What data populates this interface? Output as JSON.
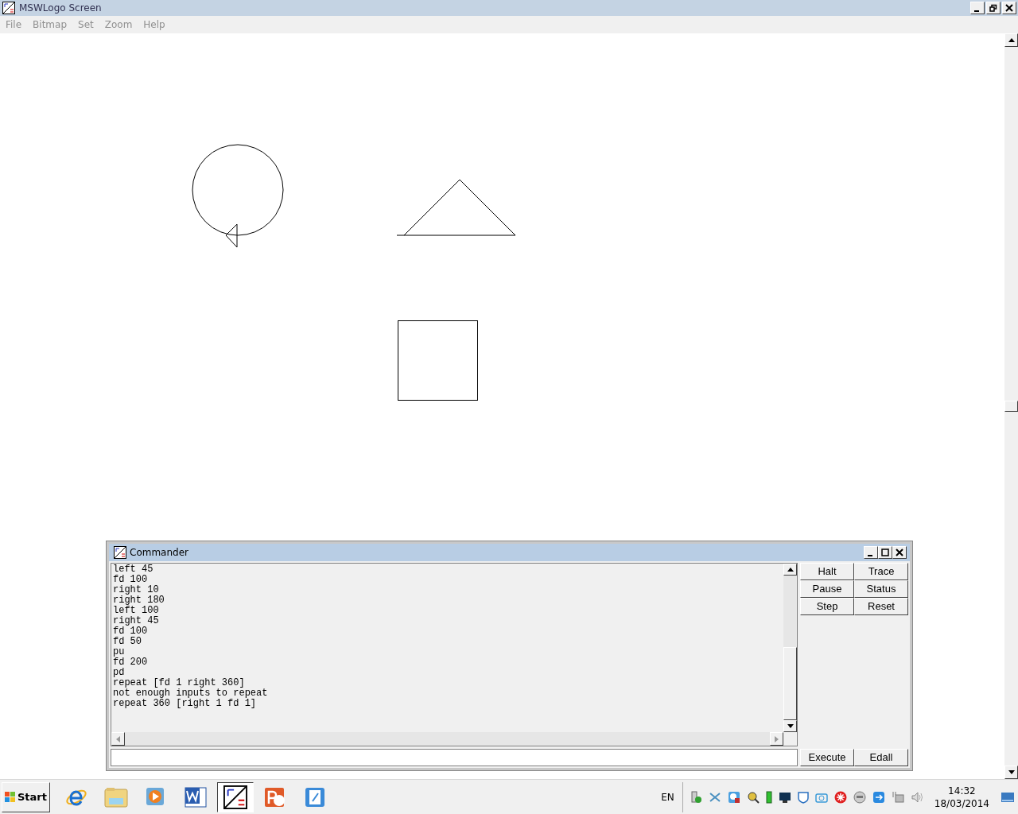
{
  "window": {
    "title": "MSWLogo Screen"
  },
  "menu": [
    "File",
    "Bitmap",
    "Set",
    "Zoom",
    "Help"
  ],
  "commander": {
    "title": "Commander",
    "history": [
      "left 45",
      "fd 100",
      "right 10",
      "right 180",
      "left 100",
      "right 45",
      "fd 100",
      "fd 50",
      "pu",
      "fd 200",
      "pd",
      "repeat [fd 1 right 360]",
      "not enough inputs to repeat",
      "repeat 360 [right 1 fd 1]"
    ],
    "buttons": [
      "Halt",
      "Trace",
      "Pause",
      "Status",
      "Step",
      "Reset"
    ],
    "bottom_buttons": [
      "Execute",
      "Edall"
    ]
  },
  "taskbar": {
    "start": "Start",
    "apps": [
      {
        "kind": "browser",
        "selected": false
      },
      {
        "kind": "folder",
        "selected": false
      },
      {
        "kind": "media",
        "selected": false
      },
      {
        "kind": "word",
        "selected": false
      },
      {
        "kind": "logo",
        "selected": true
      },
      {
        "kind": "slides",
        "selected": false
      },
      {
        "kind": "notes",
        "selected": false
      }
    ],
    "language": "EN",
    "time": "14:32",
    "date": "18/03/2014"
  }
}
